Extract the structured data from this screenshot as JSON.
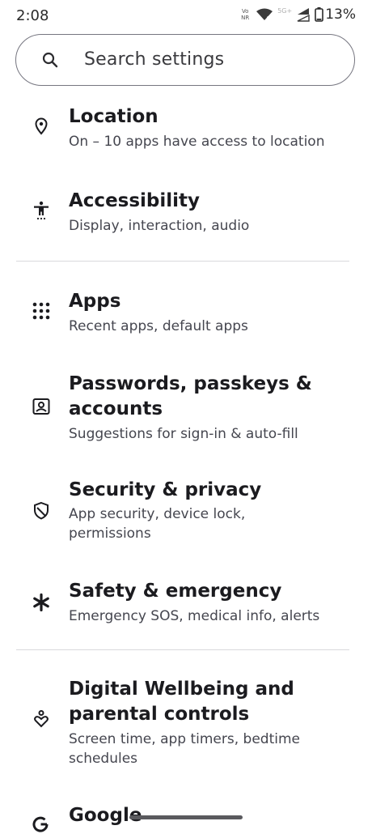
{
  "status_bar": {
    "time": "2:08",
    "volte_top": "Vo",
    "volte_bottom": "NR",
    "network": "5G+",
    "battery": "13%"
  },
  "search": {
    "placeholder": "Search settings"
  },
  "items": [
    {
      "icon": "location-pin-icon",
      "title": "Location",
      "subtitle": "On – 10 apps have access to location"
    },
    {
      "icon": "accessibility-icon",
      "title": "Accessibility",
      "subtitle": "Display, interaction, audio"
    },
    {
      "icon": "apps-grid-icon",
      "title": "Apps",
      "subtitle": "Recent apps, default apps"
    },
    {
      "icon": "account-box-icon",
      "title_line1": "Passwords, passkeys &",
      "title_line2": "accounts",
      "subtitle": "Suggestions for sign-in & auto-fill"
    },
    {
      "icon": "shield-icon",
      "title": "Security & privacy",
      "subtitle_line1": "App security, device lock,",
      "subtitle_line2": "permissions"
    },
    {
      "icon": "asterisk-icon",
      "title": "Safety & emergency",
      "subtitle": "Emergency SOS, medical info, alerts"
    },
    {
      "icon": "wellbeing-icon",
      "title_line1": "Digital Wellbeing and",
      "title_line2": "parental controls",
      "subtitle_line1": "Screen time, app timers, bedtime",
      "subtitle_line2": "schedules"
    },
    {
      "icon": "google-g-icon",
      "title": "Google"
    }
  ]
}
